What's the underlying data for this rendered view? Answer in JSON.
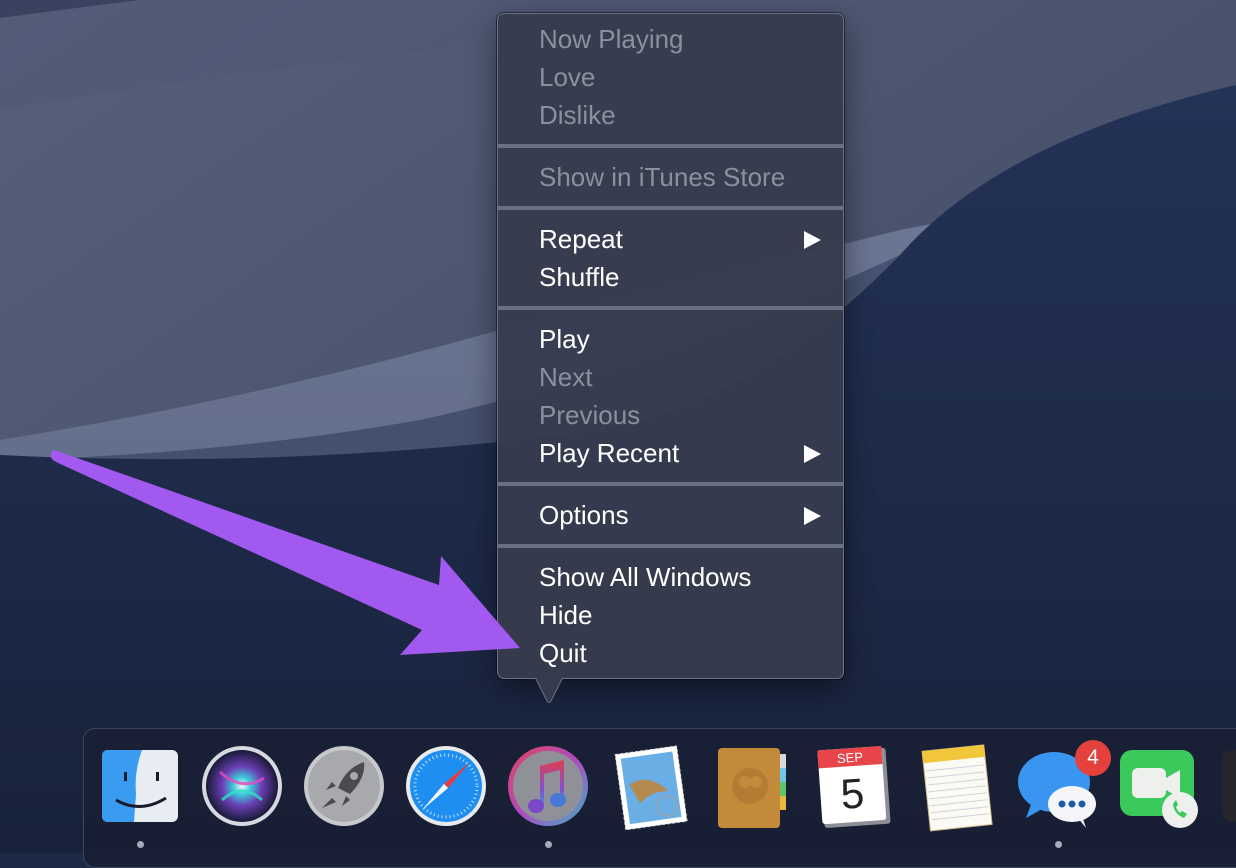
{
  "context_menu": {
    "sections": [
      {
        "items": [
          {
            "label": "Now Playing",
            "enabled": false,
            "submenu": false
          },
          {
            "label": "Love",
            "enabled": false,
            "submenu": false
          },
          {
            "label": "Dislike",
            "enabled": false,
            "submenu": false
          }
        ]
      },
      {
        "items": [
          {
            "label": "Show in iTunes Store",
            "enabled": false,
            "submenu": false
          }
        ]
      },
      {
        "items": [
          {
            "label": "Repeat",
            "enabled": true,
            "submenu": true
          },
          {
            "label": "Shuffle",
            "enabled": true,
            "submenu": false
          }
        ]
      },
      {
        "items": [
          {
            "label": "Play",
            "enabled": true,
            "submenu": false
          },
          {
            "label": "Next",
            "enabled": false,
            "submenu": false
          },
          {
            "label": "Previous",
            "enabled": false,
            "submenu": false
          },
          {
            "label": "Play Recent",
            "enabled": true,
            "submenu": true
          }
        ]
      },
      {
        "items": [
          {
            "label": "Options",
            "enabled": true,
            "submenu": true
          }
        ]
      },
      {
        "items": [
          {
            "label": "Show All Windows",
            "enabled": true,
            "submenu": false
          },
          {
            "label": "Hide",
            "enabled": true,
            "submenu": false
          },
          {
            "label": "Quit",
            "enabled": true,
            "submenu": false
          }
        ]
      }
    ]
  },
  "dock": {
    "apps": [
      {
        "name": "Finder",
        "icon": "finder-icon",
        "running": true
      },
      {
        "name": "Siri",
        "icon": "siri-icon",
        "running": false
      },
      {
        "name": "Launchpad",
        "icon": "launchpad-icon",
        "running": false
      },
      {
        "name": "Safari",
        "icon": "safari-icon",
        "running": false
      },
      {
        "name": "iTunes",
        "icon": "itunes-icon",
        "running": true
      },
      {
        "name": "Mail",
        "icon": "mail-icon",
        "running": false
      },
      {
        "name": "Contacts",
        "icon": "contacts-icon",
        "running": false
      },
      {
        "name": "Calendar",
        "icon": "calendar-icon",
        "running": false,
        "month": "SEP",
        "day": "5"
      },
      {
        "name": "Notes",
        "icon": "notes-icon",
        "running": false
      },
      {
        "name": "Messages",
        "icon": "messages-icon",
        "running": true,
        "badge": "4"
      },
      {
        "name": "FaceTime",
        "icon": "facetime-icon",
        "running": false
      }
    ]
  },
  "annotation": {
    "type": "arrow",
    "color": "#a259f0",
    "points_to": "Quit"
  },
  "colors": {
    "menu_bg": "#363c4e",
    "menu_text": "#ffffff",
    "menu_text_disabled": "#8b909e",
    "badge": "#e5413c",
    "arrow": "#a259f0"
  }
}
